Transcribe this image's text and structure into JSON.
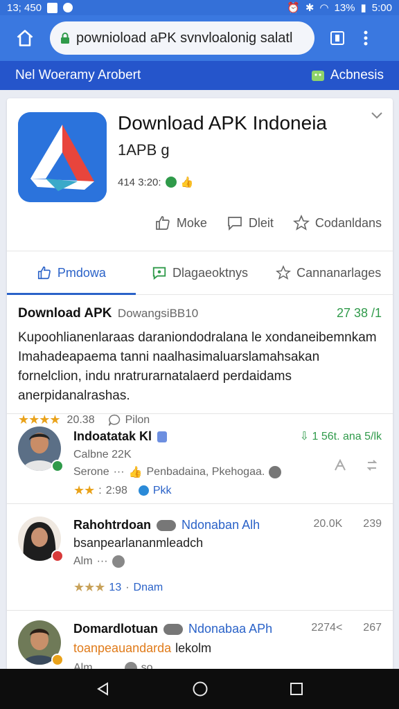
{
  "status_bar": {
    "time_left": "13; 450",
    "battery": "13%",
    "clock": "5:00"
  },
  "browser": {
    "url": "pownioload aPK svnvloalonig salatl"
  },
  "site_header": {
    "left_text": "Nel Woeramy Arobert",
    "right_text": "Acbnesis"
  },
  "app": {
    "title": "Download APK Indoneia",
    "version": "1APB g",
    "meta": "414 3:20:",
    "actions": [
      "Moke",
      "Dleit",
      "Codanldans"
    ]
  },
  "tabs": [
    "Pmdowa",
    "Dlagaeoktnys",
    "Cannanarlages"
  ],
  "description": {
    "title": "Download APK",
    "subtitle": "DowangsiBB10",
    "count": "27 38 /1",
    "body": "Kupoohlianenlaraas daraniondodralana le xondaneibemnkam Imahadeapaema tanni naalhasimaluarslamahsakan fornelclion, indu nratrurarnatalaerd perdaidams anerpidanalrashas.",
    "rating": "20.38",
    "reply": "Pilon"
  },
  "comments": [
    {
      "name": "Indoatatak Kl",
      "right": "1 56t. ana 5/lk",
      "line1": "Calbne 22K",
      "line2_a": "Serone",
      "line2_b": "Penbadaina, Pkehogaa.",
      "rating": "2:98",
      "tag": "Pkk"
    },
    {
      "name": "Rahohtrdoan",
      "tag": "Ndonaban Alh",
      "right_a": "20.0K",
      "right_b": "239",
      "line1": "bsanpearlananmleadch",
      "line2": "Alm",
      "rating": "13",
      "tag2": "Dnam"
    },
    {
      "name": "Domardlotuan",
      "tag": "Ndonabaa APh",
      "right_a": "2274<",
      "right_b": "267",
      "line1_a": "toanpeauandarda",
      "line1_b": "lekolm",
      "line2": "Alm",
      "line2_b": "so"
    }
  ],
  "colors": {
    "primary": "#3a78e0",
    "header": "#2555cb",
    "accent_green": "#2f9a4a",
    "star": "#e9a21a"
  }
}
